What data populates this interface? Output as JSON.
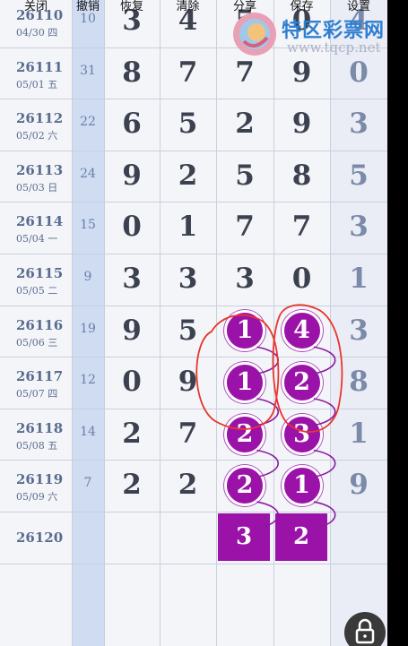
{
  "toolbar": {
    "buttons": [
      {
        "id": "close",
        "label": "关闭"
      },
      {
        "id": "undo",
        "label": "撤销"
      },
      {
        "id": "restore",
        "label": "恢复"
      },
      {
        "id": "clear",
        "label": "清除"
      },
      {
        "id": "share",
        "label": "分享"
      },
      {
        "id": "save",
        "label": "保存"
      },
      {
        "id": "settings",
        "label": "设置"
      }
    ]
  },
  "watermark": {
    "text": "特区彩票网",
    "url": "www.tqcp.net"
  },
  "colors": {
    "accent": "#9a12a8",
    "annotation": "#e8352d",
    "link_line": "#8a1aa0",
    "count_column": "#cfdcf2"
  },
  "rows": [
    {
      "issue": "26110",
      "date": "04/30 四",
      "count": "10",
      "digits": [
        "3",
        "4",
        "5",
        "0",
        "4"
      ]
    },
    {
      "issue": "26111",
      "date": "05/01 五",
      "count": "31",
      "digits": [
        "8",
        "7",
        "7",
        "9",
        "0"
      ]
    },
    {
      "issue": "26112",
      "date": "05/02 六",
      "count": "22",
      "digits": [
        "6",
        "5",
        "2",
        "9",
        "3"
      ]
    },
    {
      "issue": "26113",
      "date": "05/03 日",
      "count": "24",
      "digits": [
        "9",
        "2",
        "5",
        "8",
        "5"
      ]
    },
    {
      "issue": "26114",
      "date": "05/04 一",
      "count": "15",
      "digits": [
        "0",
        "1",
        "7",
        "7",
        "3"
      ]
    },
    {
      "issue": "26115",
      "date": "05/05 二",
      "count": "9",
      "digits": [
        "3",
        "3",
        "3",
        "0",
        "1"
      ]
    },
    {
      "issue": "26116",
      "date": "05/06 三",
      "count": "19",
      "digits": [
        "9",
        "5",
        "",
        "",
        "3"
      ],
      "balls": [
        "1",
        "4"
      ]
    },
    {
      "issue": "26117",
      "date": "05/07 四",
      "count": "12",
      "digits": [
        "0",
        "9",
        "",
        "",
        "8"
      ],
      "balls": [
        "1",
        "2"
      ]
    },
    {
      "issue": "26118",
      "date": "05/08 五",
      "count": "14",
      "digits": [
        "2",
        "7",
        "",
        "",
        "1"
      ],
      "balls": [
        "2",
        "3"
      ]
    },
    {
      "issue": "26119",
      "date": "05/09 六",
      "count": "7",
      "digits": [
        "2",
        "2",
        "",
        "",
        "9"
      ],
      "balls": [
        "2",
        "1"
      ]
    },
    {
      "issue": "26120",
      "date": "",
      "count": "",
      "digits": [
        "",
        "",
        "",
        "",
        ""
      ],
      "boxes": [
        "3",
        "2"
      ]
    }
  ],
  "lock": {
    "icon": "lock-icon"
  }
}
